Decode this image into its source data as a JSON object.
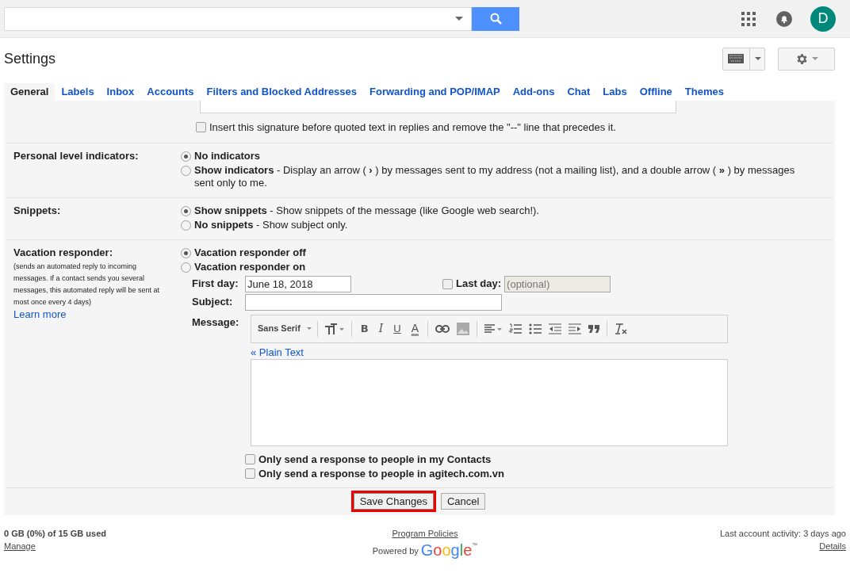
{
  "account": {
    "avatar_letter": "D"
  },
  "page_title": "Settings",
  "tabs": [
    {
      "label": "General",
      "selected": true
    },
    {
      "label": "Labels",
      "selected": false
    },
    {
      "label": "Inbox",
      "selected": false
    },
    {
      "label": "Accounts",
      "selected": false
    },
    {
      "label": "Filters and Blocked Addresses",
      "selected": false
    },
    {
      "label": "Forwarding and POP/IMAP",
      "selected": false
    },
    {
      "label": "Add-ons",
      "selected": false
    },
    {
      "label": "Chat",
      "selected": false
    },
    {
      "label": "Labs",
      "selected": false
    },
    {
      "label": "Offline",
      "selected": false
    },
    {
      "label": "Themes",
      "selected": false
    }
  ],
  "signature_option": {
    "label": "Insert this signature before quoted text in replies and remove the \"--\" line that precedes it.",
    "checked": false
  },
  "sections": [
    {
      "label": "Personal level indicators:",
      "options": [
        {
          "title": "No indicators",
          "selected": true
        },
        {
          "title": "Show indicators",
          "description": " - Display an arrow ( **›** ) by messages sent to my address (not a mailing list), and a double arrow ( **»** ) by messages sent only to me.",
          "selected": false
        }
      ]
    },
    {
      "label": "Snippets:",
      "options": [
        {
          "title": "Show snippets",
          "description": " - Show snippets of the message (like Google web search!).",
          "selected": true
        },
        {
          "title": "No snippets",
          "description": " - Show subject only.",
          "selected": false
        }
      ]
    }
  ],
  "vacation": {
    "label": "Vacation responder:",
    "note": "(sends an automated reply to incoming messages. If a contact sends you several messages, this automated reply will be sent at most once every 4 days)",
    "learn_more": "Learn more",
    "options": [
      {
        "title": "Vacation responder off",
        "selected": true
      },
      {
        "title": "Vacation responder on",
        "selected": false
      }
    ],
    "first_day": {
      "label": "First day:",
      "value": "June 18, 2018"
    },
    "last_day": {
      "label": "Last day:",
      "checked": false,
      "placeholder": "(optional)",
      "disabled": true
    },
    "subject": {
      "label": "Subject:"
    },
    "message": {
      "label": "Message:",
      "font": "Sans Serif",
      "toolbar": [
        {
          "kind": "size"
        },
        {
          "kind": "bold",
          "glyph": "B"
        },
        {
          "kind": "italic",
          "glyph": "I"
        },
        {
          "kind": "underline",
          "glyph": "U"
        },
        {
          "kind": "color",
          "glyph": "A"
        },
        {
          "kind": "link"
        },
        {
          "kind": "image"
        },
        {
          "kind": "align"
        },
        {
          "kind": "numbered"
        },
        {
          "kind": "bulleted"
        },
        {
          "kind": "outdent"
        },
        {
          "kind": "indent"
        },
        {
          "kind": "quote"
        },
        {
          "kind": "clear"
        }
      ],
      "plain_text_link": "« Plain Text"
    },
    "restrictions": [
      {
        "label": "Only send a response to people in my Contacts",
        "checked": false
      },
      {
        "label": "Only send a response to people in agitech.com.vn",
        "checked": false
      }
    ]
  },
  "buttons": [
    {
      "label": "Save Changes",
      "highlighted": true
    },
    {
      "label": "Cancel",
      "highlighted": false
    }
  ],
  "footer": {
    "storage": "0 GB (0%) of 15 GB used",
    "manage": "Manage",
    "program_policies": "Program Policies",
    "powered_by": "Powered by",
    "logo": "Google",
    "trademark": "™",
    "last_activity": "Last account activity: 3 days ago",
    "details": "Details"
  }
}
